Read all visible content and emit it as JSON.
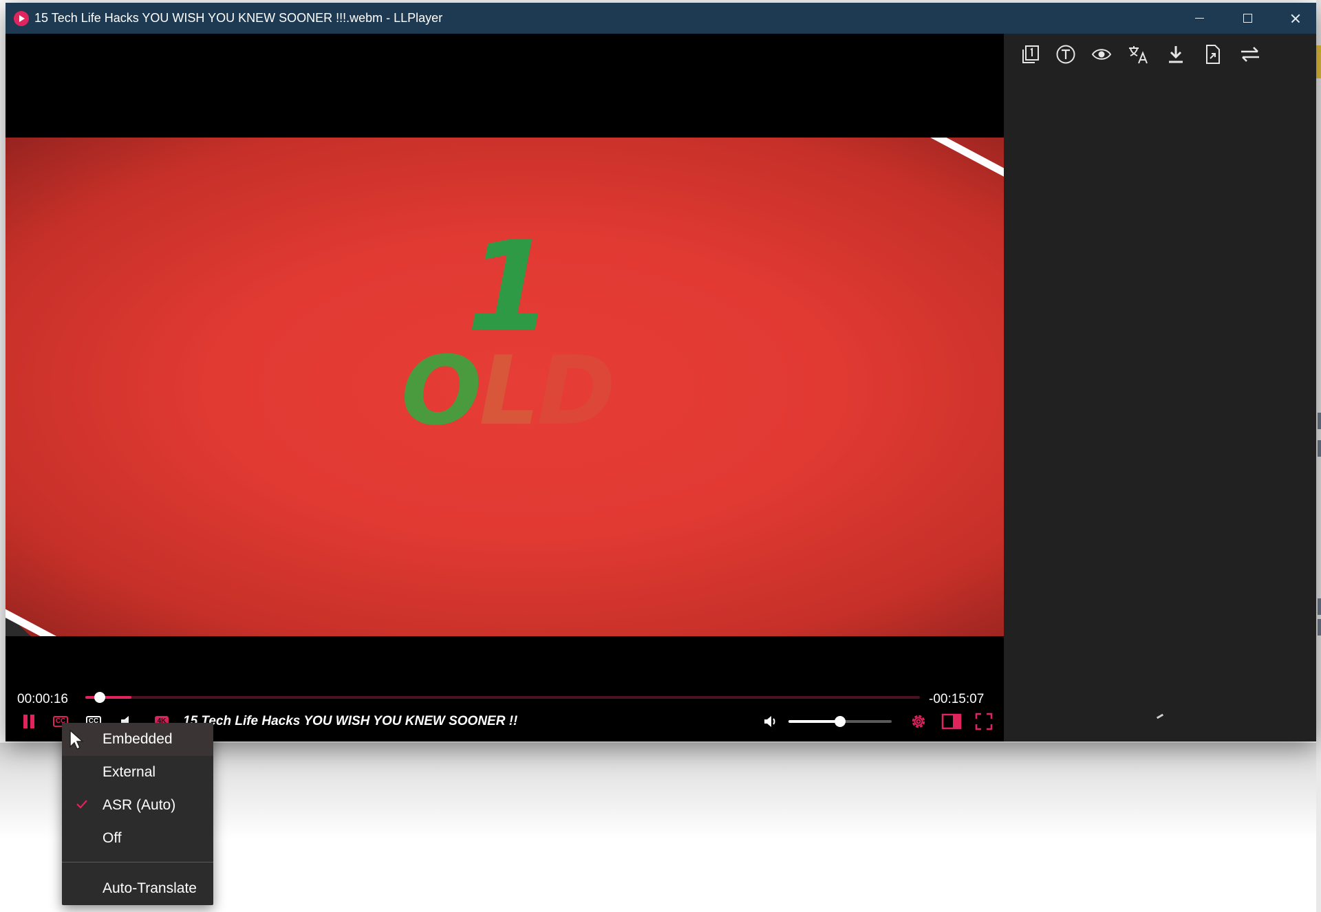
{
  "window": {
    "title": "15 Tech Life Hacks YOU WISH YOU KNEW SOONER !!!.webm - LLPlayer"
  },
  "video": {
    "frame_text_top": "1",
    "frame_text_o": "O",
    "frame_text_l": "L",
    "frame_text_d": "D"
  },
  "player": {
    "current_time": "00:00:16",
    "remaining_time": "-00:15:07",
    "progress": 0.055,
    "now_playing": "15 Tech Life Hacks YOU WISH YOU KNEW SOONER !!",
    "volume": 0.5,
    "cc_label": "CC",
    "sub2_label": "CC",
    "quality_label": "4K"
  },
  "subtitle_menu": {
    "items": [
      {
        "label": "Embedded",
        "checked": false
      },
      {
        "label": "External",
        "checked": false
      },
      {
        "label": "ASR (Auto)",
        "checked": true
      },
      {
        "label": "Off",
        "checked": false
      }
    ],
    "auto_translate": "Auto-Translate"
  },
  "colors": {
    "accent": "#e0245e",
    "titlebar": "#1e3a52",
    "panel": "#212121",
    "menu": "#2c2c2c"
  },
  "icons": [
    "pause-icon",
    "cc-icon",
    "secondary-subtitle-icon",
    "audio-track-icon",
    "quality-icon",
    "volume-icon",
    "settings-icon",
    "sidebar-toggle-icon",
    "fullscreen-icon",
    "copy-icon",
    "text-icon",
    "eye-icon",
    "translate-icon",
    "download-icon",
    "export-icon",
    "swap-icon",
    "check-icon",
    "cursor-icon"
  ]
}
